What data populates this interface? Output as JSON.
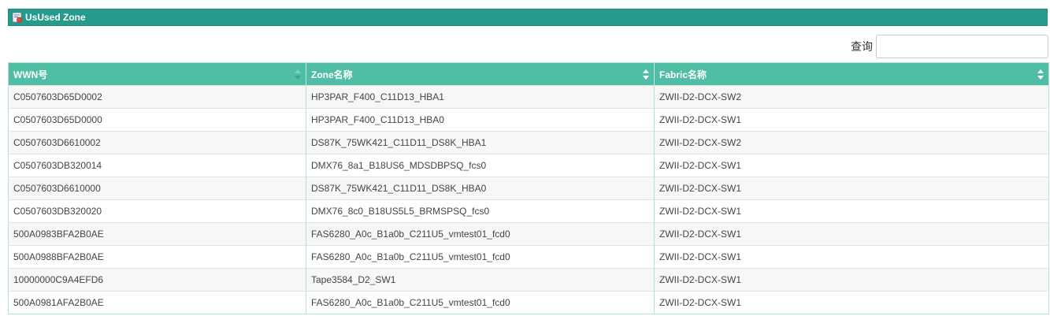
{
  "panel": {
    "title": "UsUsed Zone",
    "icon": "zone-config-icon"
  },
  "search": {
    "label": "查询",
    "value": ""
  },
  "colors": {
    "header_bar": "#259b8c",
    "table_header": "#4fbea5",
    "row_alt": "#f7f7f7"
  },
  "table": {
    "columns": [
      {
        "label": "WWN号",
        "sort": "ascending"
      },
      {
        "label": "Zone名称",
        "sort": "none"
      },
      {
        "label": "Fabric名称",
        "sort": "none"
      }
    ],
    "rows": [
      [
        "C0507603D65D0002",
        "HP3PAR_F400_C11D13_HBA1",
        "ZWII-D2-DCX-SW2"
      ],
      [
        "C0507603D65D0000",
        "HP3PAR_F400_C11D13_HBA0",
        "ZWII-D2-DCX-SW1"
      ],
      [
        "C0507603D6610002",
        "DS87K_75WK421_C11D11_DS8K_HBA1",
        "ZWII-D2-DCX-SW2"
      ],
      [
        "C0507603DB320014",
        "DMX76_8a1_B18US6_MDSDBPSQ_fcs0",
        "ZWII-D2-DCX-SW1"
      ],
      [
        "C0507603D6610000",
        "DS87K_75WK421_C11D11_DS8K_HBA0",
        "ZWII-D2-DCX-SW1"
      ],
      [
        "C0507603DB320020",
        "DMX76_8c0_B18US5L5_BRMSPSQ_fcs0",
        "ZWII-D2-DCX-SW1"
      ],
      [
        "500A0983BFA2B0AE",
        "FAS6280_A0c_B1a0b_C211U5_vmtest01_fcd0",
        "ZWII-D2-DCX-SW1"
      ],
      [
        "500A0988BFA2B0AE",
        "FAS6280_A0c_B1a0b_C211U5_vmtest01_fcd0",
        "ZWII-D2-DCX-SW1"
      ],
      [
        "10000000C9A4EFD6",
        "Tape3584_D2_SW1",
        "ZWII-D2-DCX-SW1"
      ],
      [
        "500A0981AFA2B0AE",
        "FAS6280_A0c_B1a0b_C211U5_vmtest01_fcd0",
        "ZWII-D2-DCX-SW1"
      ]
    ]
  }
}
